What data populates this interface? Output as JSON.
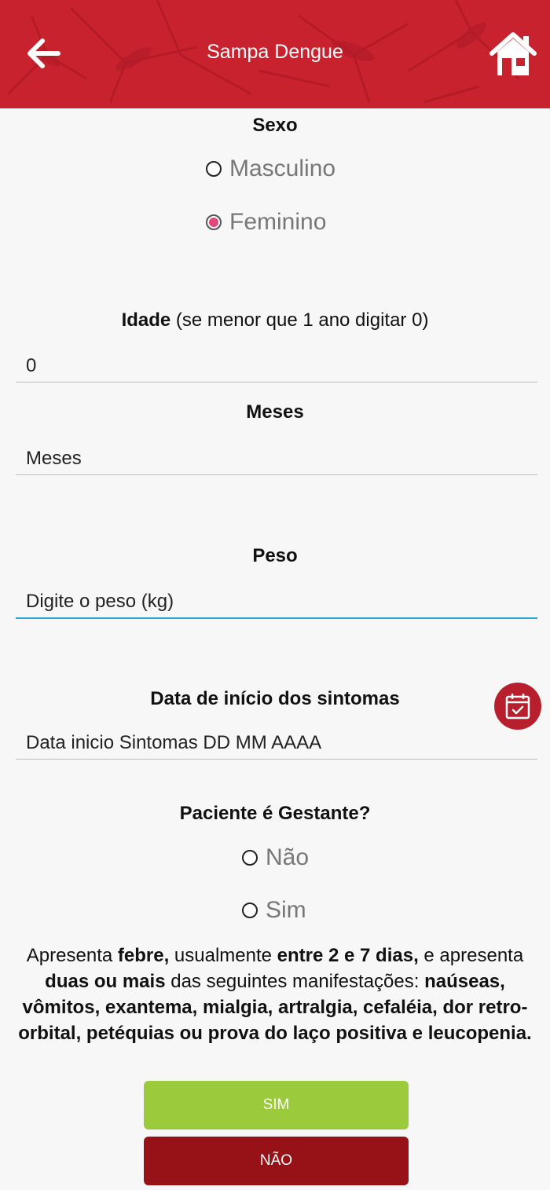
{
  "header": {
    "title": "Sampa Dengue",
    "back_icon": "arrow-left-icon",
    "home_icon": "home-icon",
    "color": "#c8222f"
  },
  "sexo": {
    "label": "Sexo",
    "options": [
      {
        "label": "Masculino",
        "checked": false
      },
      {
        "label": "Feminino",
        "checked": true
      }
    ]
  },
  "idade": {
    "label_bold": "Idade",
    "label_hint": " (se menor que 1 ano digitar 0)",
    "value": "0"
  },
  "meses": {
    "label": "Meses",
    "placeholder": "Meses"
  },
  "peso": {
    "label": "Peso",
    "placeholder": "Digite o peso (kg)"
  },
  "data_inicio": {
    "label": "Data de início dos sintomas",
    "placeholder": "Data inicio Sintomas DD MM AAAA",
    "calendar_icon": "calendar-check-icon"
  },
  "gestante": {
    "label": "Paciente é Gestante?",
    "options": [
      {
        "label": "Não",
        "checked": false
      },
      {
        "label": "Sim",
        "checked": false
      }
    ]
  },
  "description": {
    "p1": "Apresenta ",
    "b1": "febre,",
    "p2": " usualmente ",
    "b2": "entre 2 e 7 dias,",
    "p3": " e apresenta ",
    "b3": "duas ou mais",
    "p4": " das seguintes manifestações: ",
    "b4": "naúseas, vômitos, exantema, mialgia, artralgia, cefaléia, dor retro-orbital, petéquias ou prova do laço positiva e leucopenia."
  },
  "buttons": {
    "sim": "SIM",
    "nao": "NÃO",
    "sim_color": "#9bcb3c",
    "nao_color": "#961216"
  }
}
